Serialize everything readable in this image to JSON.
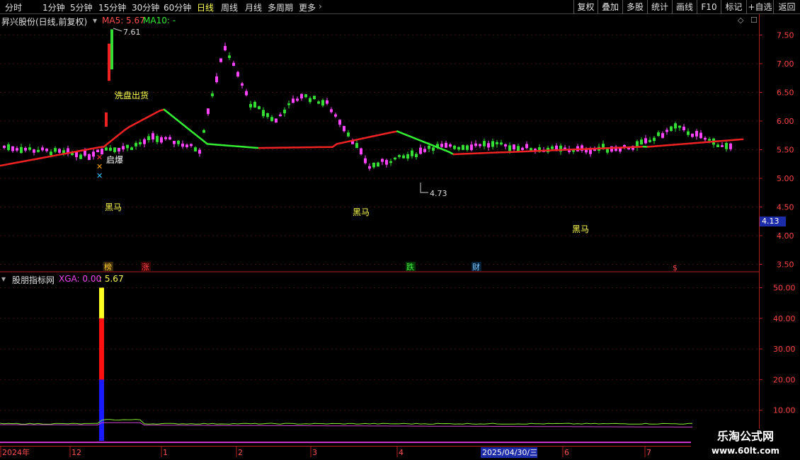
{
  "toolbar": {
    "periods": [
      "分时",
      "1分钟",
      "5分钟",
      "15分钟",
      "30分钟",
      "60分钟",
      "日线",
      "周线",
      "月线",
      "多周期",
      "更多"
    ],
    "active_period": "日线",
    "buttons": [
      "复权",
      "叠加",
      "多股",
      "统计",
      "画线",
      "F10",
      "+自选",
      "返回"
    ],
    "mark_button": "标记"
  },
  "main_panel": {
    "stock_title": "昇兴股份(日线,前复权)",
    "ma5_label": "MA5: 5.67",
    "ma10_label": "MA10: -",
    "price_axis": [
      "7.50",
      "7.00",
      "6.50",
      "6.00",
      "5.50",
      "5.00",
      "4.50",
      "4.00",
      "3.50"
    ],
    "current_price_tag": "4.13",
    "high_label": "7.61",
    "low_label": "4.73",
    "annotations": [
      "洗盘出货",
      "启爆"
    ],
    "heima_labels": [
      "黑马",
      "黑马",
      "黑马"
    ],
    "event_markers": [
      "榜",
      "涨",
      "跌",
      "财",
      "$"
    ]
  },
  "sub_panel": {
    "title": "股朋指标网",
    "xga_label": "XGA: 0.00",
    "value_label": ": 5.67",
    "axis": [
      "50.00",
      "40.00",
      "30.00",
      "20.00",
      "10.00"
    ]
  },
  "date_axis": {
    "labels": [
      "2024年",
      "12",
      "1",
      "2",
      "3",
      "4",
      "6",
      "7"
    ],
    "highlighted_date": "2025/04/30/三"
  },
  "watermark": {
    "title": "乐淘公式网",
    "url": "www.60lt.com"
  },
  "colors": {
    "up": "#ff44ff",
    "down": "#33dd33",
    "ma_up": "#ee2222",
    "ma_down": "#33ee33",
    "axis": "#b02020"
  }
}
